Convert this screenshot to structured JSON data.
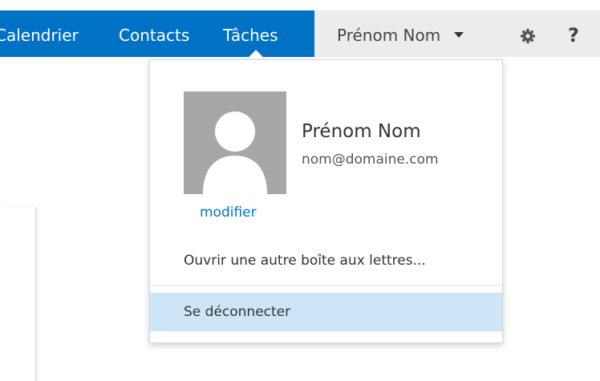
{
  "nav": {
    "items": [
      {
        "label": "Calendrier"
      },
      {
        "label": "Contacts"
      },
      {
        "label": "Tâches"
      }
    ]
  },
  "header": {
    "user_menu_label": "Prénom Nom",
    "help_label": "?"
  },
  "dropdown": {
    "user_name": "Prénom Nom",
    "user_email": "nom@domaine.com",
    "modify_label": "modifier",
    "open_other_mailbox": "Ouvrir une autre boîte aux lettres...",
    "sign_out": "Se déconnecter"
  },
  "colors": {
    "accent": "#0072c6",
    "header_right_bg": "#ececec",
    "avatar_bg": "#a7a7a7",
    "signout_highlight": "#cde6f7"
  },
  "icons": {
    "settings": "gear-icon",
    "menu_caret": "chevron-down-icon",
    "avatar": "person-icon"
  }
}
